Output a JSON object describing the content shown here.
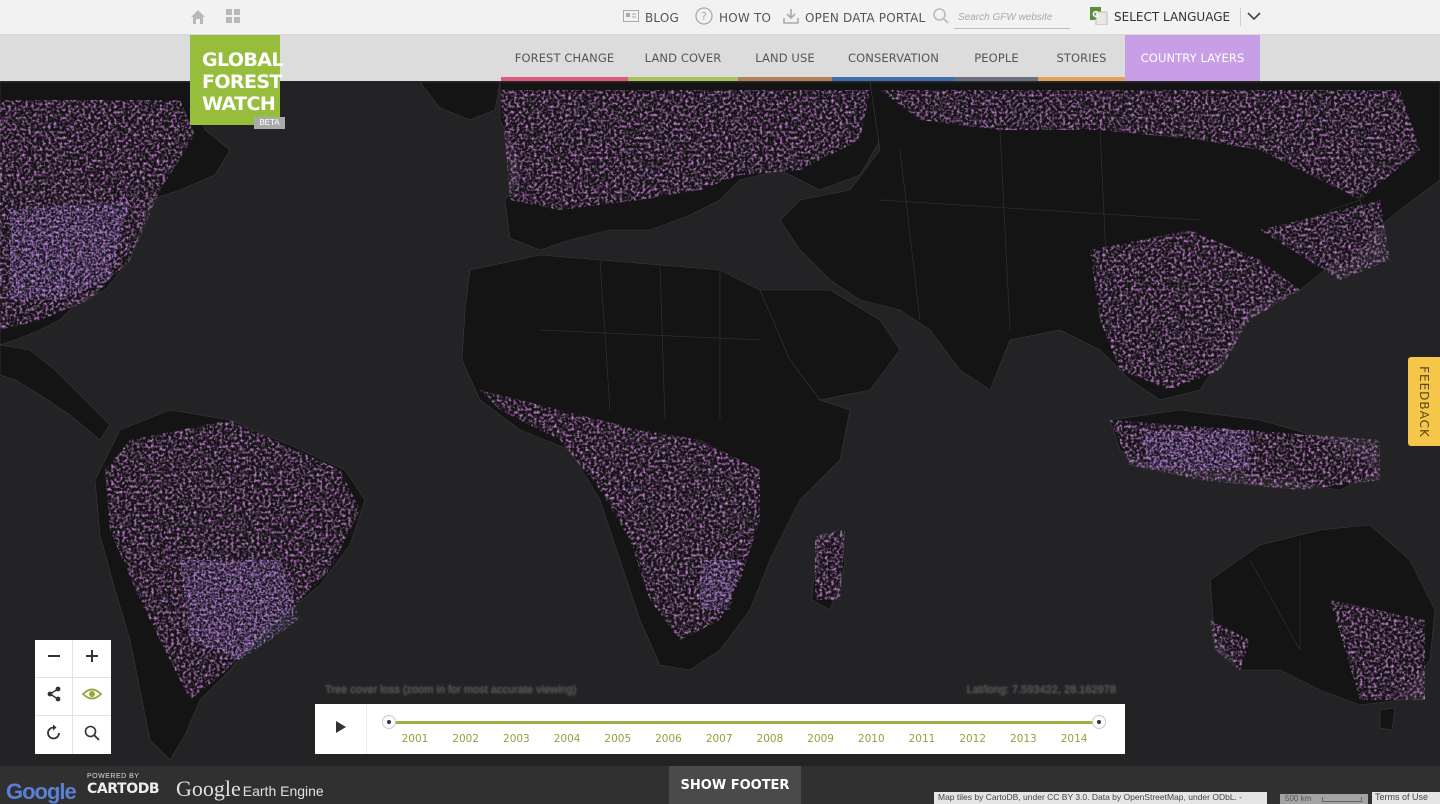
{
  "colors": {
    "brand_green": "#97bd3d",
    "timeline_green": "#94a23c",
    "map_background": "#232325",
    "land": "#141414",
    "loss_magenta": "#a03aa8",
    "loss_violet": "#6a3ed2",
    "feedback_yellow": "#f6c64a"
  },
  "topbar": {
    "home_icon": "home-icon",
    "apps_icon": "grid-icon",
    "links": [
      {
        "label": "BLOG",
        "icon": "blog-icon"
      },
      {
        "label": "HOW TO",
        "icon": "question-icon"
      },
      {
        "label": "OPEN DATA PORTAL",
        "icon": "download-icon"
      }
    ],
    "search": {
      "placeholder": "Search GFW website",
      "icon": "search-icon"
    },
    "language": {
      "label": "SELECT LANGUAGE",
      "icon": "translate-icon",
      "chevron": "chevron-down-icon"
    }
  },
  "logo": {
    "line1": "GLOBAL",
    "line2": "FOREST",
    "line3": "WATCH",
    "badge": "BETA"
  },
  "nav": {
    "items": [
      {
        "label": "FOREST CHANGE",
        "color": "#dc5a7e"
      },
      {
        "label": "LAND COVER",
        "color": "#a9c25a"
      },
      {
        "label": "LAND USE",
        "color": "#b0805a"
      },
      {
        "label": "CONSERVATION",
        "color": "#3f6fb1"
      },
      {
        "label": "PEOPLE",
        "color": "#6f6f83"
      },
      {
        "label": "STORIES",
        "color": "#e0a25a"
      },
      {
        "label": "COUNTRY LAYERS",
        "color": "#c89ee6"
      }
    ]
  },
  "controls": {
    "zoom_out": "minus-icon",
    "zoom_in": "plus-icon",
    "share": "share-icon",
    "toggle_view": "eye-icon",
    "reset": "refresh-icon",
    "search": "search-icon"
  },
  "timeline": {
    "caption": "Tree cover loss (zoom in for most accurate viewing)",
    "latlng": "Lat/long: 7.593422, 28.162978",
    "play_icon": "play-icon",
    "years": [
      "2001",
      "2002",
      "2003",
      "2004",
      "2005",
      "2006",
      "2007",
      "2008",
      "2009",
      "2010",
      "2011",
      "2012",
      "2013",
      "2014"
    ],
    "range_start": "2001",
    "range_end": "2014"
  },
  "footer": {
    "google": "Google",
    "powered_by": "POWERED BY",
    "cartodb": "CARTODB",
    "gee_google": "Google",
    "gee_label": "Earth Engine",
    "show_footer": "SHOW FOOTER",
    "attribution": "Map tiles by CartoDB, under CC BY 3.0. Data by OpenStreetMap, under ODbL. -",
    "scale": "500 km",
    "terms": "Terms of Use"
  },
  "feedback": {
    "label": "FEEDBACK"
  }
}
